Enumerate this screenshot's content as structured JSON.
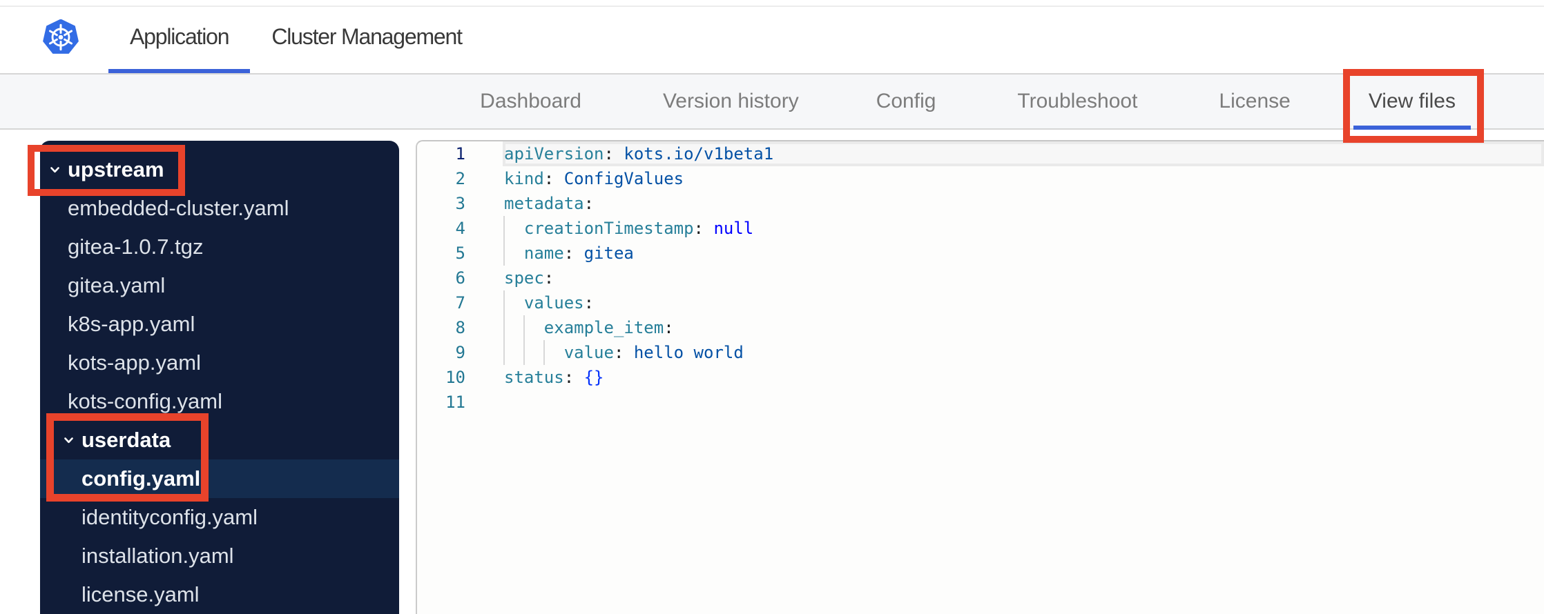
{
  "header": {
    "logo": "kubernetes-logo",
    "tabs": [
      {
        "label": "Application",
        "active": true
      },
      {
        "label": "Cluster Management",
        "active": false
      }
    ]
  },
  "subnav": {
    "tabs": [
      {
        "label": "Dashboard",
        "active": false
      },
      {
        "label": "Version history",
        "active": false
      },
      {
        "label": "Config",
        "active": false
      },
      {
        "label": "Troubleshoot",
        "active": false
      },
      {
        "label": "License",
        "active": false
      },
      {
        "label": "View files",
        "active": true
      }
    ]
  },
  "file_tree": {
    "items": [
      {
        "label": "upstream",
        "type": "folder",
        "level": 0,
        "expanded": true,
        "selected": false
      },
      {
        "label": "embedded-cluster.yaml",
        "type": "file",
        "level": 1,
        "selected": false
      },
      {
        "label": "gitea-1.0.7.tgz",
        "type": "file",
        "level": 1,
        "selected": false
      },
      {
        "label": "gitea.yaml",
        "type": "file",
        "level": 1,
        "selected": false
      },
      {
        "label": "k8s-app.yaml",
        "type": "file",
        "level": 1,
        "selected": false
      },
      {
        "label": "kots-app.yaml",
        "type": "file",
        "level": 1,
        "selected": false
      },
      {
        "label": "kots-config.yaml",
        "type": "file",
        "level": 1,
        "selected": false
      },
      {
        "label": "userdata",
        "type": "folder",
        "level": 1,
        "expanded": true,
        "selected": false
      },
      {
        "label": "config.yaml",
        "type": "file",
        "level": 2,
        "selected": true
      },
      {
        "label": "identityconfig.yaml",
        "type": "file",
        "level": 2,
        "selected": false
      },
      {
        "label": "installation.yaml",
        "type": "file",
        "level": 2,
        "selected": false
      },
      {
        "label": "license.yaml",
        "type": "file",
        "level": 2,
        "selected": false
      }
    ]
  },
  "editor": {
    "language": "yaml",
    "current_line": 1,
    "lines": [
      {
        "number": 1,
        "guides": [],
        "tokens": [
          [
            "key",
            "apiVersion"
          ],
          [
            "punc",
            ":"
          ],
          [
            "plain",
            " "
          ],
          [
            "val",
            "kots.io/v1beta1"
          ]
        ]
      },
      {
        "number": 2,
        "guides": [],
        "tokens": [
          [
            "key",
            "kind"
          ],
          [
            "punc",
            ":"
          ],
          [
            "plain",
            " "
          ],
          [
            "val",
            "ConfigValues"
          ]
        ]
      },
      {
        "number": 3,
        "guides": [],
        "tokens": [
          [
            "key",
            "metadata"
          ],
          [
            "punc",
            ":"
          ]
        ]
      },
      {
        "number": 4,
        "guides": [
          0
        ],
        "tokens": [
          [
            "plain",
            "  "
          ],
          [
            "key",
            "creationTimestamp"
          ],
          [
            "punc",
            ":"
          ],
          [
            "plain",
            " "
          ],
          [
            "kw",
            "null"
          ]
        ]
      },
      {
        "number": 5,
        "guides": [
          0
        ],
        "tokens": [
          [
            "plain",
            "  "
          ],
          [
            "key",
            "name"
          ],
          [
            "punc",
            ":"
          ],
          [
            "plain",
            " "
          ],
          [
            "val",
            "gitea"
          ]
        ]
      },
      {
        "number": 6,
        "guides": [],
        "tokens": [
          [
            "key",
            "spec"
          ],
          [
            "punc",
            ":"
          ]
        ]
      },
      {
        "number": 7,
        "guides": [
          0
        ],
        "tokens": [
          [
            "plain",
            "  "
          ],
          [
            "key",
            "values"
          ],
          [
            "punc",
            ":"
          ]
        ]
      },
      {
        "number": 8,
        "guides": [
          0,
          1
        ],
        "tokens": [
          [
            "plain",
            "    "
          ],
          [
            "key",
            "example_item"
          ],
          [
            "punc",
            ":"
          ]
        ]
      },
      {
        "number": 9,
        "guides": [
          0,
          1,
          2
        ],
        "tokens": [
          [
            "plain",
            "      "
          ],
          [
            "key",
            "value"
          ],
          [
            "punc",
            ":"
          ],
          [
            "plain",
            " "
          ],
          [
            "val",
            "hello world"
          ]
        ]
      },
      {
        "number": 10,
        "guides": [],
        "tokens": [
          [
            "key",
            "status"
          ],
          [
            "punc",
            ":"
          ],
          [
            "plain",
            " "
          ],
          [
            "brace",
            "{}"
          ]
        ]
      },
      {
        "number": 11,
        "guides": [],
        "tokens": []
      }
    ]
  },
  "annotations": {
    "color": "#e8432b",
    "boxes": [
      {
        "target": "upstream-folder"
      },
      {
        "target": "userdata-config-yaml"
      },
      {
        "target": "view-files-tab"
      }
    ]
  },
  "colors": {
    "accent_blue": "#3b62d9",
    "logo_blue": "#326ce5",
    "annotation_red": "#e8432b",
    "sidebar_bg": "#101c38",
    "sidebar_selected_bg": "#142c4e",
    "subnav_bg": "#f6f7f9",
    "code_key": "#267f99",
    "code_value": "#0451a5",
    "code_keyword": "#0000ff",
    "line_number": "#237893"
  }
}
